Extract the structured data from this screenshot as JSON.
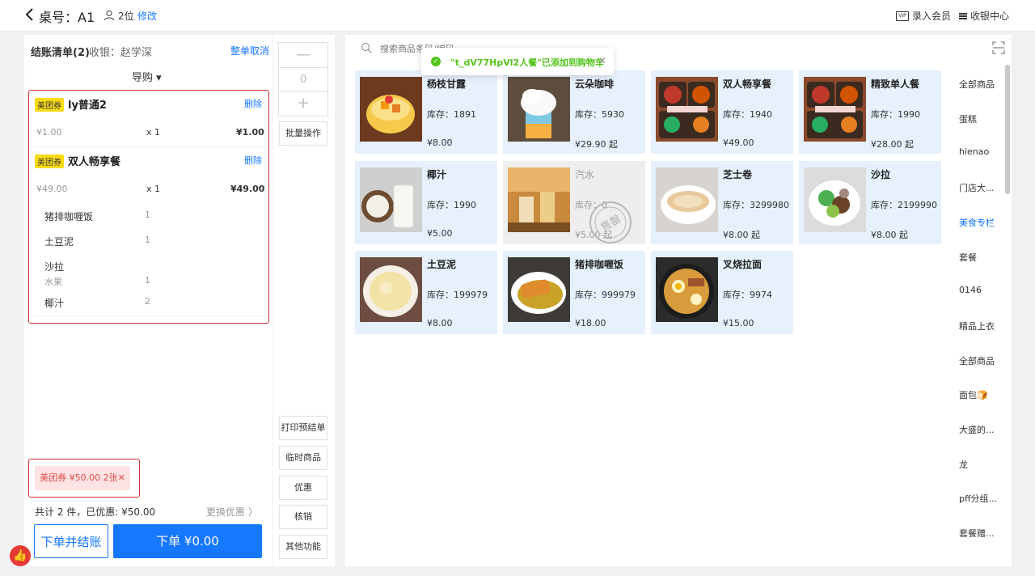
{
  "header": {
    "table_label": "桌号：A1",
    "people": "2位",
    "modify": "修改",
    "member_label": "录入会员",
    "vip_icon_text": "VIP",
    "cashier_center": "收银中心"
  },
  "bill": {
    "title": "结账清单(2)",
    "cashier": "收银：赵学深",
    "cancel_all": "整单取消",
    "guide": "导购 ▾",
    "items": [
      {
        "badge": "美团券",
        "name": "ly普通2",
        "delete": "删除",
        "unit_price": "¥1.00",
        "qty": "x 1",
        "total": "¥1.00"
      },
      {
        "badge": "美团券",
        "name": "双人畅享餐",
        "delete": "删除",
        "unit_price": "¥49.00",
        "qty": "x 1",
        "total": "¥49.00",
        "sub_items": [
          {
            "name": "猪排咖喱饭",
            "qty": "1"
          },
          {
            "name": "土豆泥",
            "qty": "1"
          },
          {
            "name": "沙拉",
            "note": "水果",
            "qty": "1"
          },
          {
            "name": "椰汁",
            "qty": "2"
          }
        ]
      }
    ],
    "coupon": "美团券 ¥50.00 2张✕",
    "summary": "共计 2 件，已优惠: ¥50.00",
    "change_discount": "更换优惠 〉",
    "order_pay": "下单并结账",
    "order": "下单 ¥0.00"
  },
  "middle": {
    "minus": "—",
    "value": "0",
    "plus": "+",
    "batch": "批量操作",
    "print_pre": "打印预结单",
    "temp_goods": "临时商品",
    "discount": "优惠",
    "verify": "核销",
    "other": "其他功能"
  },
  "search": {
    "placeholder": "搜索商品条码/编码"
  },
  "toast": {
    "text": "\"t_dV77HpVl2人餐\"已添加到购物车"
  },
  "products": [
    {
      "name": "杨枝甘露",
      "stock": "库存：1891",
      "price": "¥8.00",
      "img": "mango"
    },
    {
      "name": "云朵咖啡",
      "stock": "库存：5930",
      "price": "¥29.90 起",
      "img": "cloud"
    },
    {
      "name": "双人畅享餐",
      "stock": "库存：1940",
      "price": "¥49.00",
      "img": "bento"
    },
    {
      "name": "精致单人餐",
      "stock": "库存：1990",
      "price": "¥28.00 起",
      "img": "bento"
    },
    {
      "name": "椰汁",
      "stock": "库存：1990",
      "price": "¥5.00",
      "img": "coconut"
    },
    {
      "name": "汽水",
      "stock": "库存：0",
      "price": "¥5.00 起",
      "img": "soda",
      "disabled": true
    },
    {
      "name": "芝士卷",
      "stock": "库存：3299980",
      "price": "¥8.00 起",
      "img": "roll"
    },
    {
      "name": "沙拉",
      "stock": "库存：2199990",
      "price": "¥8.00 起",
      "img": "salad"
    },
    {
      "name": "土豆泥",
      "stock": "库存：199979",
      "price": "¥8.00",
      "img": "mash"
    },
    {
      "name": "猪排咖喱饭",
      "stock": "库存：999979",
      "price": "¥18.00",
      "img": "curry"
    },
    {
      "name": "叉烧拉面",
      "stock": "库存：9974",
      "price": "¥15.00",
      "img": "ramen"
    }
  ],
  "sold_out_stamp": "售罄",
  "categories": [
    {
      "label": "全部商品"
    },
    {
      "label": "蛋糕"
    },
    {
      "label": "hienao"
    },
    {
      "label": "门店大..."
    },
    {
      "label": "美食专栏",
      "active": true
    },
    {
      "label": "套餐"
    },
    {
      "label": "0146"
    },
    {
      "label": "精品上衣"
    },
    {
      "label": "全部商品"
    },
    {
      "label": "面包🍞"
    },
    {
      "label": "大盛的..."
    },
    {
      "label": "龙"
    },
    {
      "label": "pff分组..."
    },
    {
      "label": "套餐赠..."
    }
  ],
  "colors": {
    "accent": "#1677ff",
    "danger": "#d32f2f",
    "success": "#52c41a",
    "badge": "#fadb14",
    "card_bg": "#e6f1fd"
  }
}
